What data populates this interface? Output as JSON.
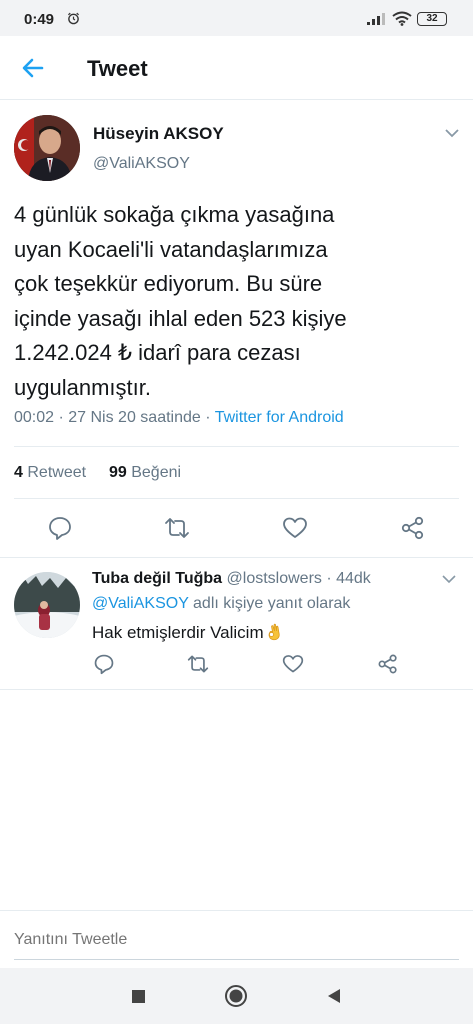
{
  "status_bar": {
    "time": "0:49",
    "battery": "32",
    "icons": [
      "alarm-icon",
      "signal-icon",
      "wifi-icon",
      "battery-icon"
    ]
  },
  "app_bar": {
    "title": "Tweet",
    "back_icon": "arrow-left-icon",
    "accent": "#1da1f2"
  },
  "tweet": {
    "author_name": "Hüseyin AKSOY",
    "author_handle": "@ValiAKSOY",
    "text": "4 günlük sokağa çıkma yasağına\nuyan Kocaeli'li vatandaşlarımıza\nçok teşekkür ediyorum. Bu süre\niçinde yasağı ihlal eden 523 kişiye\n1.242.024 ₺  idarî para cezası\nuygulanmıştır.",
    "meta_time": "00:02 · 27 Nis 20 saatinde · ",
    "source": "Twitter for Android",
    "retweet_count": "4",
    "retweet_label": "Retweet",
    "like_count": "99",
    "like_label": "Beğeni",
    "actions": [
      "reply-icon",
      "retweet-icon",
      "like-icon",
      "share-icon"
    ]
  },
  "reply": {
    "name": "Tuba değil Tuğba",
    "handle": "@lostslowers",
    "time": "44dk",
    "reply_to_mention": "@ValiAKSOY",
    "reply_to_suffix": " adlı kişiye yanıt olarak",
    "text": "Hak etmişlerdir Valicim",
    "emoji": "ok-hand-icon",
    "actions": [
      "reply-icon",
      "retweet-icon",
      "like-icon",
      "share-icon"
    ]
  },
  "compose": {
    "placeholder": "Yanıtını Tweetle"
  },
  "nav_bar": {
    "buttons": [
      "recents-square-icon",
      "home-circle-icon",
      "back-triangle-icon"
    ]
  },
  "colors": {
    "link": "#1b95e0",
    "secondary_text": "#657786",
    "primary_text": "#14171a",
    "divider": "#e6ecf0"
  }
}
